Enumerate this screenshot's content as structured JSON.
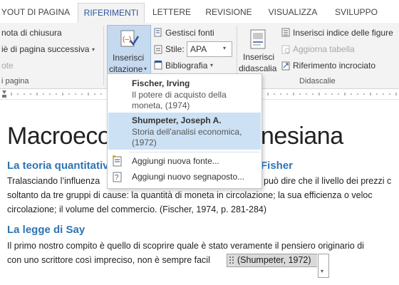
{
  "tabs": [
    "YOUT DI PAGINA",
    "RIFERIMENTI",
    "LETTERE",
    "REVISIONE",
    "VISUALIZZA",
    "SVILUPPO"
  ],
  "ribbon": {
    "note_chiusura": "nota di chiusura",
    "pie_pagina": "iè di pagina successiva",
    "note": "ote",
    "group_pagina": "i pagina",
    "inserisci_citazione_1": "Inserisci",
    "inserisci_citazione_2": "citazione",
    "gestisci_fonti": "Gestisci fonti",
    "stile_label": "Stile:",
    "stile_value": "APA",
    "bibliografia": "Bibliografia",
    "inserisci_didascalia_1": "Inserisci",
    "inserisci_didascalia_2": "didascalia",
    "inserisci_indice_figure": "Inserisci indice delle figure",
    "aggiorna_tabella": "Aggiorna tabella",
    "riferimento_incrociato": "Riferimento incrociato",
    "group_didascalie": "Didascalie"
  },
  "menu": {
    "items": [
      {
        "name": "Fischer, Irving",
        "desc1": "Il potere di acquisto della",
        "desc2": "moneta, (1974)"
      },
      {
        "name": "Shumpeter, Joseph A.",
        "desc1": "Storia dell'analisi economica,",
        "desc2": "(1972)"
      }
    ],
    "add_source": "Aggiungi nuova fonte...",
    "add_placeholder": "Aggiungi nuovo segnaposto..."
  },
  "document": {
    "title_left": "Macroeco",
    "title_right": "nesiana",
    "h1_left": "La teoria quantitativ",
    "h1_right": "Fisher",
    "p1_line1_left": "Tralasciando l’influenza",
    "p1_line1_right": "può dire che il livello dei prezzi c",
    "p1_line2": "soltanto da tre gruppi di cause: la quantità di moneta in circolazione; la sua efficienza o veloc",
    "p1_line3": "circolazione; il volume del commercio. (Fischer, 1974, p. 281-284)",
    "h2": "La legge di Say",
    "p2_line1": "Il primo nostro compito è quello di scoprire quale è stato veramente il pensiero originario di",
    "p2_line2": "con uno scrittore così impreciso, non è sempre facil",
    "citation": "(Shumpeter, 1972)"
  },
  "colors": {
    "accent": "#2b579a",
    "heading": "#2e74b5",
    "selection": "#cde1f5"
  }
}
